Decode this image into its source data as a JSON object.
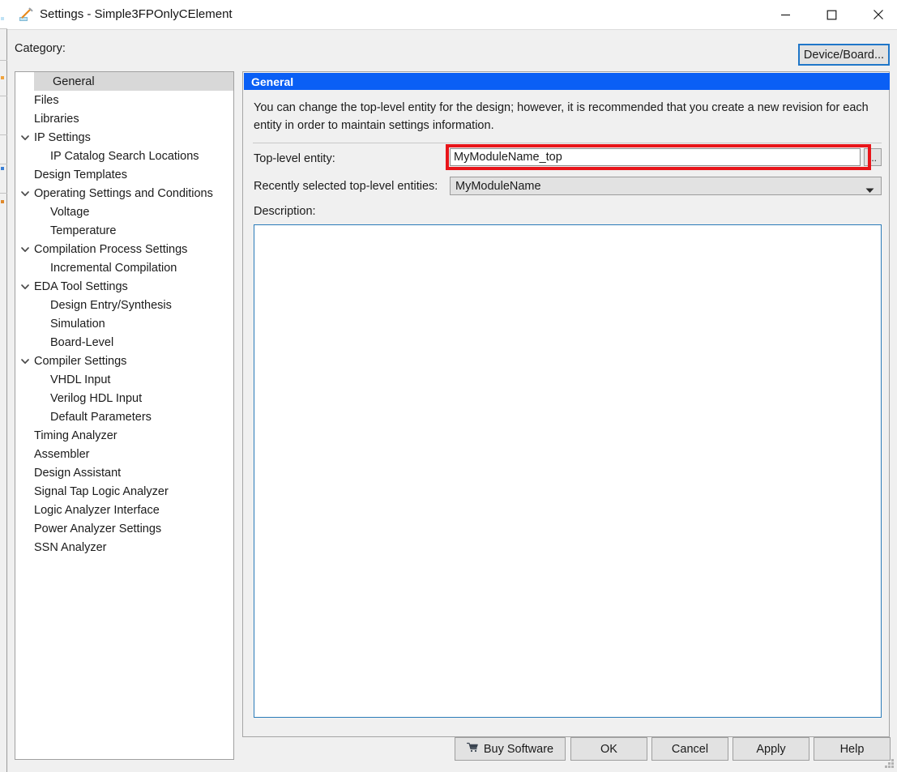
{
  "window": {
    "title": "Settings - Simple3FPOnlyCElement",
    "icon": "pencil-ruler-icon",
    "controls": {
      "minimize": "minimize-icon",
      "maximize": "maximize-icon",
      "close": "close-icon"
    }
  },
  "toolbar": {
    "category_label": "Category:",
    "device_board_label": "Device/Board..."
  },
  "tree": {
    "items": [
      {
        "label": "General",
        "level": 0,
        "expander": false,
        "selected": true
      },
      {
        "label": "Files",
        "level": 0,
        "expander": false,
        "selected": false
      },
      {
        "label": "Libraries",
        "level": 0,
        "expander": false,
        "selected": false
      },
      {
        "label": "IP Settings",
        "level": 0,
        "expander": true,
        "selected": false
      },
      {
        "label": "IP Catalog Search Locations",
        "level": 1,
        "expander": false,
        "selected": false
      },
      {
        "label": "Design Templates",
        "level": 0,
        "expander": false,
        "selected": false
      },
      {
        "label": "Operating Settings and Conditions",
        "level": 0,
        "expander": true,
        "selected": false
      },
      {
        "label": "Voltage",
        "level": 1,
        "expander": false,
        "selected": false
      },
      {
        "label": "Temperature",
        "level": 1,
        "expander": false,
        "selected": false
      },
      {
        "label": "Compilation Process Settings",
        "level": 0,
        "expander": true,
        "selected": false
      },
      {
        "label": "Incremental Compilation",
        "level": 1,
        "expander": false,
        "selected": false
      },
      {
        "label": "EDA Tool Settings",
        "level": 0,
        "expander": true,
        "selected": false
      },
      {
        "label": "Design Entry/Synthesis",
        "level": 1,
        "expander": false,
        "selected": false
      },
      {
        "label": "Simulation",
        "level": 1,
        "expander": false,
        "selected": false
      },
      {
        "label": "Board-Level",
        "level": 1,
        "expander": false,
        "selected": false
      },
      {
        "label": "Compiler Settings",
        "level": 0,
        "expander": true,
        "selected": false
      },
      {
        "label": "VHDL Input",
        "level": 1,
        "expander": false,
        "selected": false
      },
      {
        "label": "Verilog HDL Input",
        "level": 1,
        "expander": false,
        "selected": false
      },
      {
        "label": "Default Parameters",
        "level": 1,
        "expander": false,
        "selected": false
      },
      {
        "label": "Timing Analyzer",
        "level": 0,
        "expander": false,
        "selected": false
      },
      {
        "label": "Assembler",
        "level": 0,
        "expander": false,
        "selected": false
      },
      {
        "label": "Design Assistant",
        "level": 0,
        "expander": false,
        "selected": false
      },
      {
        "label": "Signal Tap Logic Analyzer",
        "level": 0,
        "expander": false,
        "selected": false
      },
      {
        "label": "Logic Analyzer Interface",
        "level": 0,
        "expander": false,
        "selected": false
      },
      {
        "label": "Power Analyzer Settings",
        "level": 0,
        "expander": false,
        "selected": false
      },
      {
        "label": "SSN Analyzer",
        "level": 0,
        "expander": false,
        "selected": false
      }
    ]
  },
  "panel": {
    "header": "General",
    "description_text": "You can change the top-level entity for the design; however, it is recommended that you create a new revision for each entity in order to maintain settings information.",
    "top_level_entity_label": "Top-level entity:",
    "top_level_entity_value": "MyModuleName_top",
    "browse_button_label": "...",
    "recent_entities_label": "Recently selected top-level entities:",
    "recent_entities_value": "MyModuleName",
    "description_label": "Description:",
    "description_value": ""
  },
  "buttons": {
    "buy_software": "Buy Software",
    "buy_icon": "shopping-cart-icon",
    "ok": "OK",
    "cancel": "Cancel",
    "apply": "Apply",
    "help": "Help"
  },
  "colors": {
    "panel_header_blue": "#0a5ff5",
    "highlight_red": "#e8151a",
    "focus_blue": "#1f76c8",
    "desc_border_blue": "#2a7bb8",
    "tree_selected_gray": "#d8d8d8",
    "dialog_bg": "#f0f0f0",
    "button_bg": "#e2e2e2"
  }
}
